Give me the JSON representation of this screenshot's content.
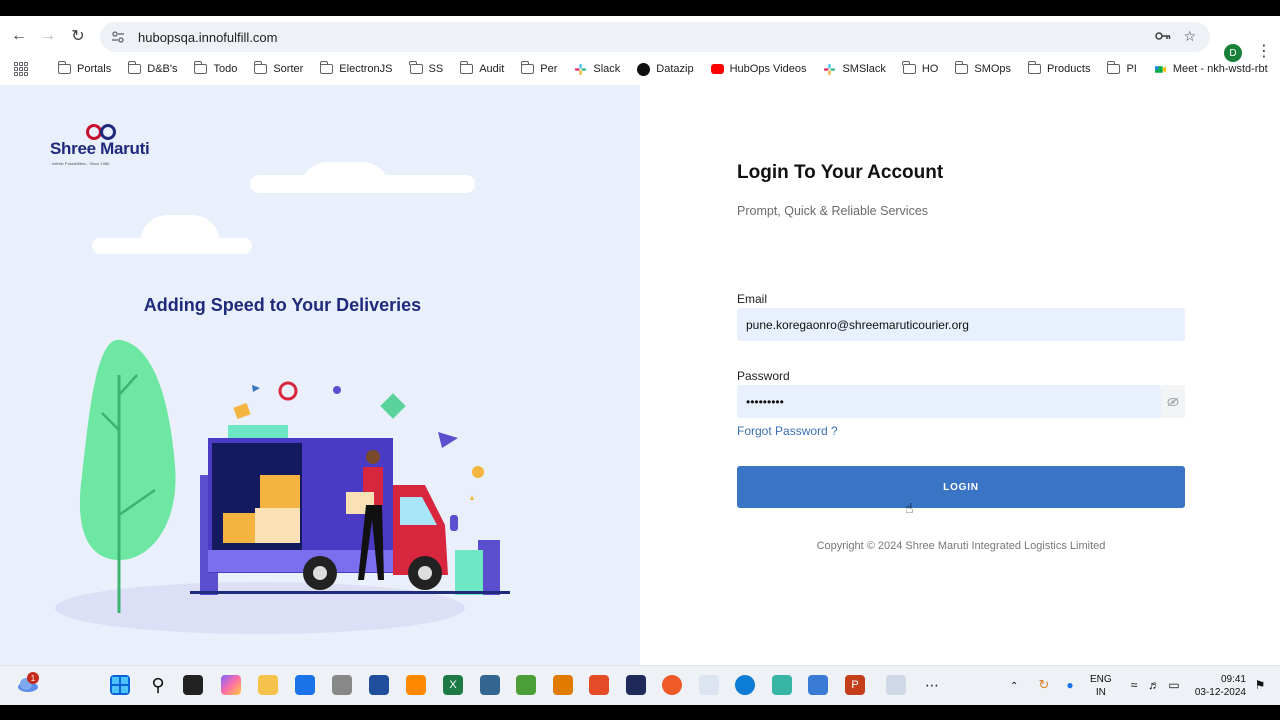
{
  "browser": {
    "url": "hubopsqa.innofulfill.com",
    "profile_initial": "D",
    "bookmarks": [
      "Portals",
      "D&B's",
      "Todo",
      "Sorter",
      "ElectronJS",
      "SS",
      "Audit",
      "Per",
      "Slack",
      "Datazip",
      "HubOps Videos",
      "SMSlack",
      "HO",
      "SMOps",
      "Products",
      "PI",
      "Meet - nkh-wstd-rbt"
    ]
  },
  "hero": {
    "logo_text": "Shree Maruti",
    "logo_subtext": "Infinite Possibilities - Since 1986",
    "title": "Adding Speed to Your Deliveries"
  },
  "login": {
    "title": "Login To Your Account",
    "subtitle": "Prompt, Quick & Reliable Services",
    "email_label": "Email",
    "email_value": "pune.koregaonro@shreemaruticourier.org",
    "password_label": "Password",
    "password_value": "•••••••••",
    "forgot_label": "Forgot Password ?",
    "button_label": "LOGIN",
    "copyright": "Copyright © 2024 Shree Maruti Integrated Logistics Limited"
  },
  "taskbar": {
    "weather_badge": "1",
    "lang_line1": "ENG",
    "lang_line2": "IN",
    "time": "09:41",
    "date": "03-12-2024"
  },
  "colors": {
    "brand_navy": "#1f2a7c",
    "accent_blue": "#3a74c4",
    "link_blue": "#3a6fb5",
    "hero_bg": "#eaf0fb",
    "input_bg": "#e8f0fe"
  }
}
